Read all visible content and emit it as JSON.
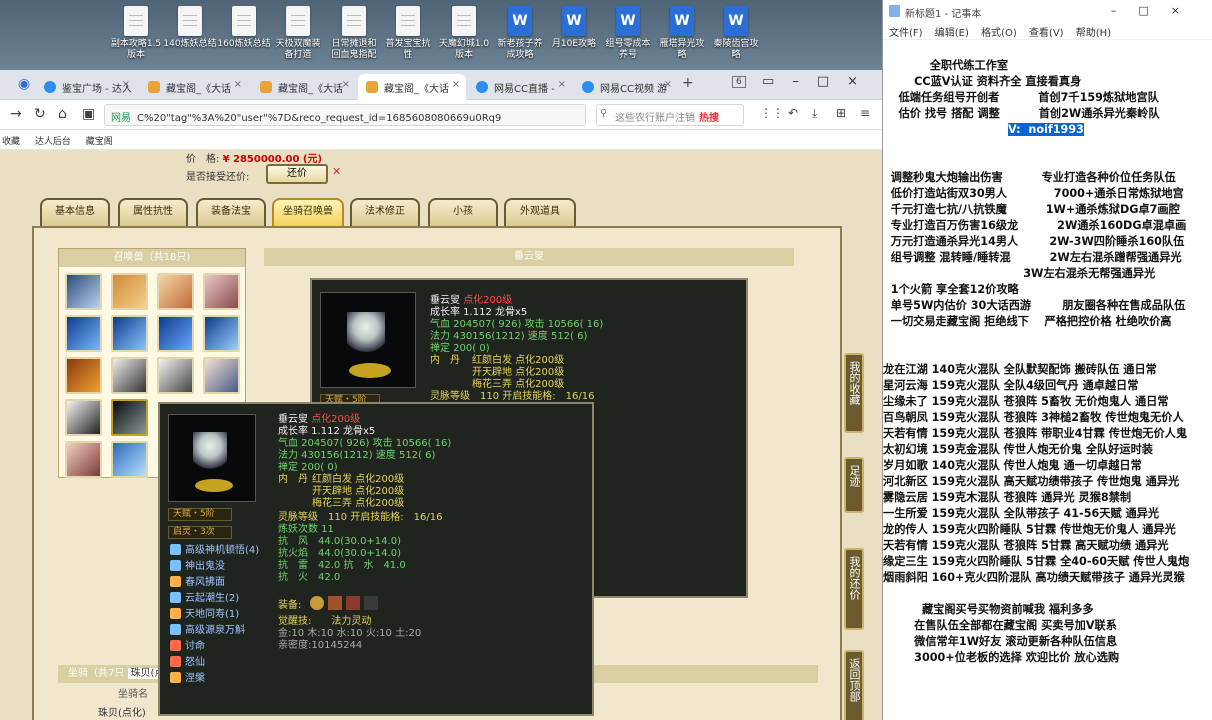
{
  "desktop": {
    "icons": [
      {
        "label": "副本攻略1.5\n版本",
        "type": "doc"
      },
      {
        "label": "140炼妖总结",
        "type": "doc"
      },
      {
        "label": "160炼妖总结",
        "type": "doc"
      },
      {
        "label": "天极双魔装\n备打造",
        "type": "doc"
      },
      {
        "label": "日常摊退和\n回血鬼指配",
        "type": "doc"
      },
      {
        "label": "普发宝宝抗\n性",
        "type": "doc"
      },
      {
        "label": "天魔幻城1.0\n版本",
        "type": "doc"
      },
      {
        "label": "新老孩子养\n成攻略",
        "type": "word"
      },
      {
        "label": "月10E攻略",
        "type": "word"
      },
      {
        "label": "组号零成本\n养号",
        "type": "word"
      },
      {
        "label": "雁塔异光攻\n略",
        "type": "word"
      },
      {
        "label": "秦陵齿宫攻\n略",
        "type": "word"
      }
    ]
  },
  "browser": {
    "tabs": [
      {
        "label": "鉴宝广场 - 达人"
      },
      {
        "label": "藏宝阁_《大话"
      },
      {
        "label": "藏宝阁_《大话"
      },
      {
        "label": "藏宝阁_《大话",
        "active": true
      },
      {
        "label": "网易CC直播 -"
      },
      {
        "label": "网易CC视频 游"
      }
    ],
    "tab_count": "6",
    "url_site": "网易",
    "url": "C%20\"tag\"%3A%20\"user\"%7D&reco_request_id=1685608080669u0Rq9",
    "search_placeholder": "这些农行账户注销",
    "search_hot": "热搜",
    "bookmarks": [
      "收藏",
      "达人后台",
      "藏宝阁"
    ]
  },
  "page": {
    "price_label": "价　格:",
    "price_value": "¥ 2850000.00 (元)",
    "counter_label": "是否接受还价:",
    "counter_button": "还价",
    "tabs": [
      "基本信息",
      "属性抗性",
      "装备法宝",
      "坐骑召唤兽",
      "法术修正",
      "小孩",
      "外观道具"
    ],
    "active_tab": "坐骑召唤兽",
    "pet_list_title": "召唤兽（共18只)",
    "detail_title": "垂云叟",
    "mount_title": "坐骑（共7只",
    "mount_select": "珠贝(点",
    "mount_col": "坐骑名",
    "mount_row": "珠贝(点化)",
    "side_buttons": [
      "我的收藏",
      "足迹",
      "我的还价",
      "返回顶部"
    ]
  },
  "popup_back": {
    "name": "垂云叟",
    "name_tag": "点化200级",
    "growth": "成长率 1.112 龙骨x5",
    "qixue": "气血 204507( 926) 攻击 10566( 16)",
    "fali": "法力 430156(1212) 速度 512( 6)",
    "chengding": "禅定 200( 0)",
    "dan_label": "内　丹",
    "dan1": "红颜白发 点化200级",
    "dan2": "开天辟地 点化200级",
    "dan3": "梅花三弄 点化200级",
    "lingxing": "灵脉等级　110 开启技能格:　16/16",
    "badge": "天赋・5阶"
  },
  "popup_front": {
    "name": "垂云叟",
    "name_tag": "点化200级",
    "growth": "成长率 1.112 龙骨x5",
    "qixue": "气血 204507( 926) 攻击 10566( 16)",
    "fali": "法力 430156(1212) 速度 512( 6)",
    "chengding": "禅定 200( 0)",
    "dan_label": "内　丹",
    "dan1": "红颜白发 点化200级",
    "dan2": "开天辟地 点化200级",
    "dan3": "梅花三弄 点化200级",
    "lingxing": "灵脉等级　110 开启技能格:　16/16",
    "lianyao": "炼妖次数 11",
    "kang_feng": "抗　风　44.0(30.0+14.0)",
    "kang_huo": "抗火焰　44.0(30.0+14.0)",
    "kang_lei": "抗　雷　42.0 抗　水　41.0",
    "kang_huo2": "抗　火　42.0",
    "badge1": "天赋・5阶",
    "badge2": "启灵・3次",
    "skills": [
      {
        "name": "高级神机顿悟(4)",
        "color": "#7ac0ff"
      },
      {
        "name": "神出鬼没",
        "color": "#7ac0ff"
      },
      {
        "name": "春风拂面",
        "color": "#ffb04a"
      },
      {
        "name": "云起潮生(2)",
        "color": "#7ac0ff"
      },
      {
        "name": "天地同寿(1)",
        "color": "#ffb04a"
      },
      {
        "name": "高级源泉万斛",
        "color": "#7ac0ff"
      },
      {
        "name": "讨命",
        "color": "#ff6a4a"
      },
      {
        "name": "怒仙",
        "color": "#ff6a4a"
      },
      {
        "name": "涅槃",
        "color": "#ffb04a"
      }
    ],
    "equip_label": "装备:",
    "awaken": "觉醒技:　　法力灵动",
    "wuxing": "金:10 木:10 水:10 火:10 土:20",
    "lingmi": "亲密度:10145244"
  },
  "notepad": {
    "title": "新标题1 - 记事本",
    "menu": [
      "文件(F)",
      "编辑(E)",
      "格式(O)",
      "查看(V)",
      "帮助(H)"
    ],
    "lines": [
      "",
      "            全职代练工作室",
      "        CC蓝V认证 资料齐全 直接看真身",
      "    低端任务组号开创者          首创7千159炼狱地宫队",
      "    估价 找号 搭配 调整          首创2W通杀异光秦岭队",
      "",
      "",
      "  调整秒鬼大炮输出伤害          专业打造各种价位任务队伍",
      "  低价打造站街双30男人            7000+通杀日常炼狱地宫",
      "  千元打造七抗/八抗铁魔          1W+通杀炼狱DG卓7画腔",
      "  专业打造百万伤害16级龙          2W通杀160DG卓混卓画",
      "  万元打造通杀异光14男人        2W-3W四阶睡杀160队伍",
      "  组号调整 混转睡/睡转混          2W左右混杀蹭帮强通异光",
      "                                    3W左右混杀无帮强通异光",
      "  1个火箭 享全套12价攻略",
      "  单号5W内估价 30大话西游        朋友圈各种在售成品队伍",
      "  一切交易走藏宝阁 拒绝线下    严格把控价格 杜绝吹价高",
      "",
      "",
      "龙在江湖 140克火混队 全队默契配饰 搬砖队伍 通日常",
      "星河云海 159克火混队 全队4级回气丹 通卓越日常",
      "尘缘未了 159克火混队 苍狼阵 5畜牧 无价炮鬼人 通日常",
      "百鸟朝凤 159克火混队 苍狼阵 3神槌2畜牧 传世炮鬼无价人",
      "天若有情 159克火混队 苍狼阵 带职业4甘霖 传世炮无价人鬼",
      "太初幻境 159克金混队 传世人炮无价鬼 全队好运时装",
      "岁月如歌 140克火混队 传世人炮鬼 通一切卓越日常",
      "河北新区 159克火混队 高天赋功绩带孩子 传世炮鬼 通异光",
      "雾隐云居 159克木混队 苍狼阵 通异光 灵猴8禁制",
      "一生所爱 159克火混队 全队带孩子 41-56天赋 通异光",
      "龙的传人 159克火四阶睡队 5甘霖 传世炮无价鬼人 通异光",
      "天若有情 159克火混队 苍狼阵 5甘霖 高天赋功绩 通异光",
      "缘定三生 159克火四阶睡队 5甘霖 全40-60天赋 传世人鬼炮",
      "烟雨斜阳 160+克火四阶混队 高功绩天赋带孩子 通异光灵猴",
      "",
      "          藏宝阁买号买物资前喊我 福利多多",
      "        在售队伍全部都在藏宝阁 买卖号加V联系",
      "        微信常年1W好友 滚动更新各种队伍信息",
      "        3000+位老板的选择 欢迎比价 放心选购"
    ],
    "highlight": "V:  noif1993"
  }
}
